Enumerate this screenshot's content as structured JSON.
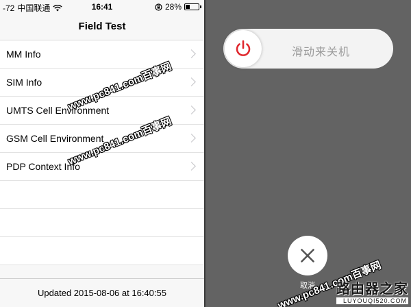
{
  "status_bar": {
    "signal": "-72",
    "carrier": "中国联通",
    "time": "16:41",
    "battery": "28%",
    "battery_level": 0.28
  },
  "nav": {
    "title": "Field Test"
  },
  "menu_items": [
    {
      "label": "MM Info"
    },
    {
      "label": "SIM Info"
    },
    {
      "label": "UMTS Cell Environment"
    },
    {
      "label": "GSM Cell Environment"
    },
    {
      "label": "PDP Context Info"
    }
  ],
  "footer": {
    "updated": "Updated 2015-08-06 at 16:40:55"
  },
  "power_off": {
    "slide_text": "滑动来关机",
    "cancel_label": "取消",
    "power_icon_color": "#e0282e"
  },
  "watermarks": {
    "text": "www.pc841.com百事网",
    "logo_main": "路由器之家",
    "logo_sub": "LUYOUQI520.COM"
  }
}
